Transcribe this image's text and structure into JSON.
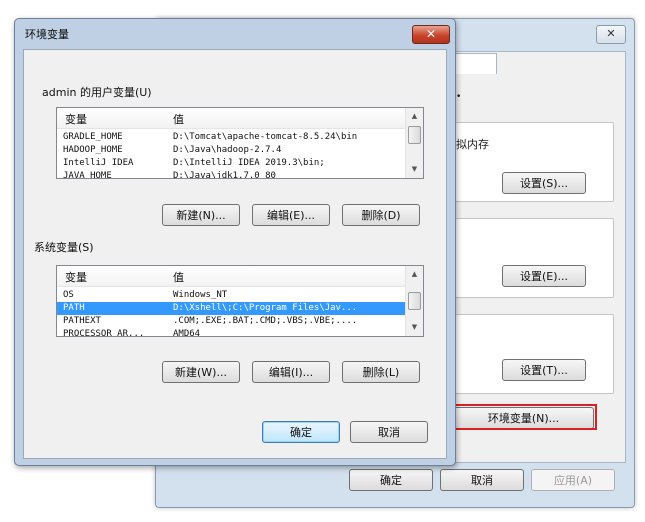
{
  "system_properties": {
    "close_icon": "✕",
    "virtual_memory_text": "拟内存",
    "settings1": "设置(S)...",
    "settings2": "设置(E)...",
    "settings3": "设置(T)...",
    "env_vars_button": "环境变量(N)...",
    "ok": "确定",
    "cancel": "取消",
    "apply": "应用(A)",
    "highlight_color": "#e02020"
  },
  "env_dialog": {
    "title": "环境变量",
    "close_icon": "✕",
    "user_section_label": "admin 的用户变量(U)",
    "system_section_label": "系统变量(S)",
    "column_variable": "变量",
    "column_value": "值",
    "user_vars": [
      {
        "name": "GRADLE_HOME",
        "value": "D:\\Tomcat\\apache-tomcat-8.5.24\\bin"
      },
      {
        "name": "HADOOP_HOME",
        "value": "D:\\Java\\hadoop-2.7.4"
      },
      {
        "name": "IntelliJ IDEA",
        "value": "D:\\IntelliJ IDEA 2019.3\\bin;"
      },
      {
        "name": "JAVA_HOME",
        "value": "D:\\Java\\jdk1.7.0_80"
      }
    ],
    "system_vars": [
      {
        "name": "OS",
        "value": "Windows_NT"
      },
      {
        "name": "PATH",
        "value": "D:\\Xshell\\;C:\\Program Files\\Jav..."
      },
      {
        "name": "PATHEXT",
        "value": ".COM;.EXE;.BAT;.CMD;.VBS;.VBE;...."
      },
      {
        "name": "PROCESSOR_AR...",
        "value": "AMD64"
      }
    ],
    "selected_system_var": "PATH",
    "user_buttons": {
      "new": "新建(N)...",
      "edit": "编辑(E)...",
      "delete": "删除(D)"
    },
    "system_buttons": {
      "new": "新建(W)...",
      "edit": "编辑(I)...",
      "delete": "删除(L)"
    },
    "ok": "确定",
    "cancel": "取消",
    "scroll_up": "▲",
    "scroll_down": "▼"
  }
}
